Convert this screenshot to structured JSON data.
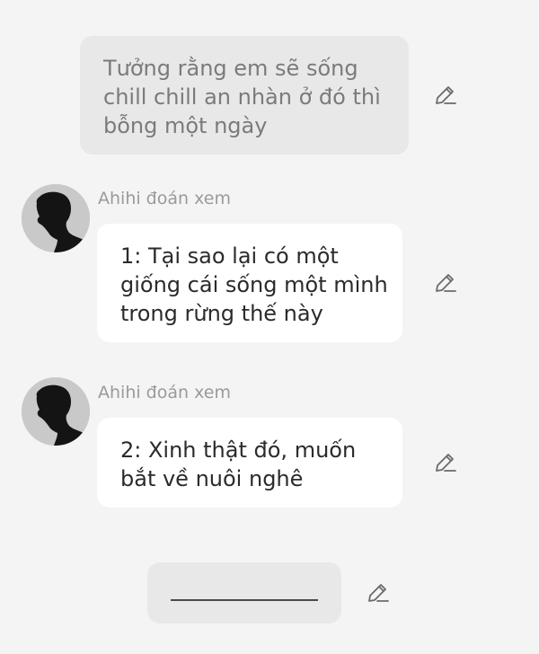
{
  "messages": [
    {
      "type": "user",
      "text": "Tưởng rằng em sẽ sống chill chill an nhàn ở đó thì bỗng một ngày"
    },
    {
      "type": "bot",
      "sender": "Ahihi đoán xem",
      "text": "1: Tại sao lại có một giống cái sống một mình trong rừng thế này"
    },
    {
      "type": "bot",
      "sender": "Ahihi đoán xem",
      "text": "2: Xinh thật đó, muốn bắt về nuôi nghê"
    },
    {
      "type": "user-input",
      "text": ""
    }
  ],
  "icons": {
    "edit": "pencil-icon",
    "avatar": "silhouette-avatar"
  }
}
